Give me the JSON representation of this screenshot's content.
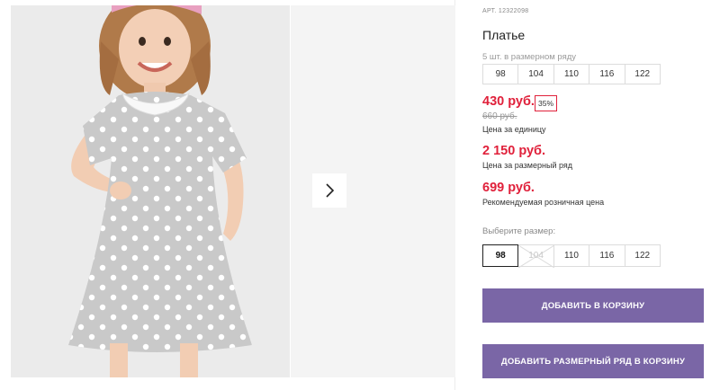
{
  "product": {
    "article": "АРТ. 12322098",
    "title": "Платье",
    "series_note": "5 шт. в размерном ряду",
    "series_sizes": [
      "98",
      "104",
      "110",
      "116",
      "122"
    ],
    "price": "430 руб.",
    "discount": "35%",
    "old_price": "660 руб.",
    "price_caption": "Цена за единицу",
    "series_price": "2 150 руб.",
    "series_caption": "Цена за размерный ряд",
    "retail_price": "699 руб.",
    "retail_caption": "Рекомендуемая розничная цена",
    "choose_size_label": "Выберите размер:",
    "size_options": [
      "98",
      "104",
      "110",
      "116",
      "122"
    ],
    "selected_size": "98",
    "disabled_size": "104"
  },
  "actions": {
    "add_to_cart": "ДОБАВИТЬ В КОРЗИНУ",
    "add_series_to_cart": "ДОБАВИТЬ РАЗМЕРНЫЙ РЯД В КОРЗИНУ"
  },
  "colors": {
    "accent": "#7a66a6",
    "price": "#e0213b"
  }
}
